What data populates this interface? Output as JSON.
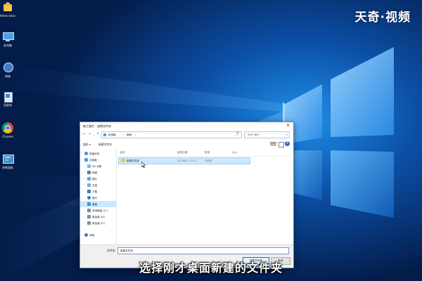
{
  "watermark": "天奇·视频",
  "caption": "选择刚才桌面新建的文件夹",
  "desktop_icons": [
    {
      "label": "Administrator",
      "icon": "user-folder-icon"
    },
    {
      "label": "此电脑",
      "icon": "this-pc-icon"
    },
    {
      "label": "网络",
      "icon": "network-icon"
    },
    {
      "label": "回收站",
      "icon": "recycle-bin-icon"
    },
    {
      "label": "Chrome",
      "icon": "chrome-icon"
    },
    {
      "label": "控制面板",
      "icon": "control-panel-icon"
    }
  ],
  "dialog": {
    "title": "新工具栏 - 选择文件夹",
    "close": "✕",
    "address": [
      "此电脑",
      "›",
      "桌面",
      "›"
    ],
    "search_placeholder": "搜索\"桌面\"",
    "commands": {
      "organize": "组织 ▾",
      "new_folder": "新建文件夹",
      "help": "?"
    },
    "nav_tree": [
      {
        "label": "快速访问",
        "icon": "star-icon",
        "color": "#3a8ee6"
      },
      {
        "label": "此电脑",
        "icon": "this-pc-icon",
        "color": "#4aa0e8"
      },
      {
        "label": "3D 对象",
        "icon": "cube-icon",
        "color": "#6fb6ef"
      },
      {
        "label": "视频",
        "icon": "video-icon",
        "color": "#5a7fa6"
      },
      {
        "label": "图片",
        "icon": "pictures-icon",
        "color": "#5fa2dc"
      },
      {
        "label": "文档",
        "icon": "documents-icon",
        "color": "#8fa7c2"
      },
      {
        "label": "下载",
        "icon": "download-icon",
        "color": "#2d7fd3"
      },
      {
        "label": "音乐",
        "icon": "music-icon",
        "color": "#2d7fd3"
      },
      {
        "label": "桌面",
        "icon": "desktop-icon",
        "color": "#3f8fd6",
        "selected": true
      },
      {
        "label": "本地磁盘 (C:)",
        "icon": "drive-icon",
        "color": "#7f8c9a"
      },
      {
        "label": "新加卷 (D:)",
        "icon": "drive-icon",
        "color": "#7f8c9a"
      },
      {
        "label": "新加卷 (E:)",
        "icon": "drive-icon",
        "color": "#7f8c9a"
      },
      {
        "label": "网络",
        "icon": "network-icon",
        "color": "#3d7cc9"
      }
    ],
    "columns": [
      "名称",
      "修改日期",
      "类型",
      "大小"
    ],
    "rows": [
      {
        "name": "新建文件夹",
        "modified": "2019/6/1 15:11",
        "type": "文件夹",
        "size": ""
      }
    ],
    "folder_label": "文件夹:",
    "folder_value": "新建文件夹",
    "select_button": "选择文件夹",
    "cancel_button": "取消"
  },
  "colors": {
    "selection": "#cce8ff",
    "accent": "#0078d7",
    "folder": "#f3c744"
  }
}
